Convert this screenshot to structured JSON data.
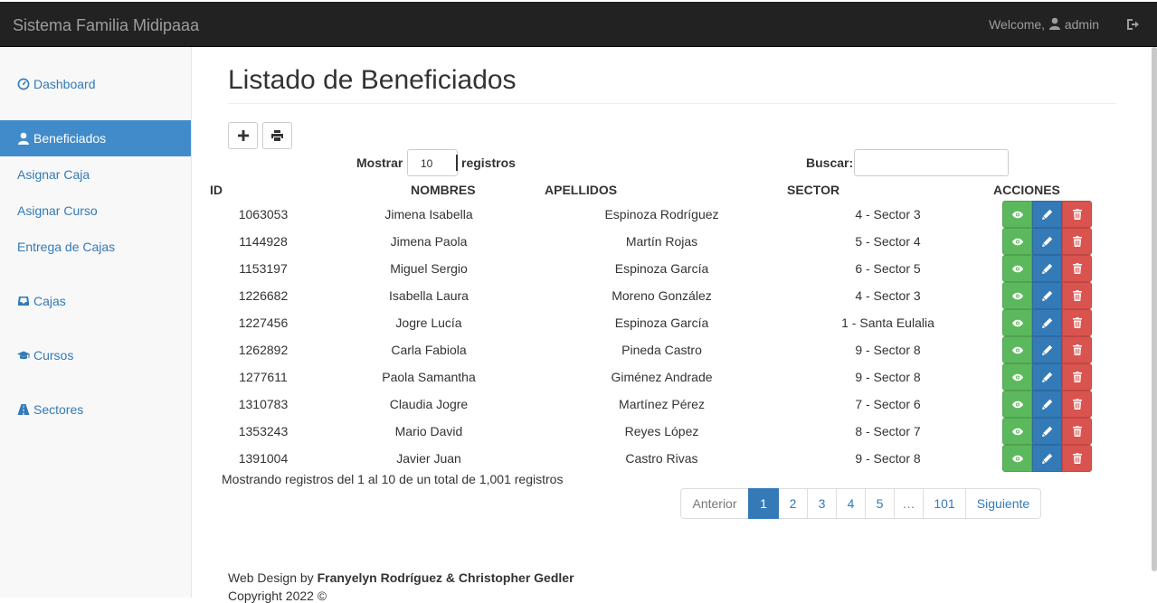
{
  "header": {
    "brand": "Sistema Familia Midipaaa",
    "welcome_prefix": "Welcome,",
    "user": "admin"
  },
  "sidebar": {
    "items": [
      {
        "label": "Dashboard",
        "icon": "dashboard-icon"
      },
      {
        "label": "Beneficiados",
        "icon": "user-icon",
        "active": true
      },
      {
        "label": "Asignar Caja"
      },
      {
        "label": "Asignar Curso"
      },
      {
        "label": "Entrega de Cajas"
      },
      {
        "label": "Cajas",
        "icon": "inbox-icon"
      },
      {
        "label": "Cursos",
        "icon": "graduation-cap-icon"
      },
      {
        "label": "Sectores",
        "icon": "road-icon"
      }
    ]
  },
  "main": {
    "title": "Listado de Beneficiados",
    "length_prefix": "Mostrar",
    "length_value": "10",
    "length_suffix": "registros",
    "search_label": "Buscar:",
    "search_value": "",
    "columns": [
      "ID",
      "NOMBRES",
      "APELLIDOS",
      "SECTOR",
      "ACCIONES"
    ],
    "rows": [
      {
        "id": "1063053",
        "nombres": "Jimena Isabella",
        "apellidos": "Espinoza Rodríguez",
        "sector": "4 - Sector 3"
      },
      {
        "id": "1144928",
        "nombres": "Jimena Paola",
        "apellidos": "Martín Rojas",
        "sector": "5 - Sector 4"
      },
      {
        "id": "1153197",
        "nombres": "Miguel Sergio",
        "apellidos": "Espinoza García",
        "sector": "6 - Sector 5"
      },
      {
        "id": "1226682",
        "nombres": "Isabella Laura",
        "apellidos": "Moreno González",
        "sector": "4 - Sector 3"
      },
      {
        "id": "1227456",
        "nombres": "Jogre Lucía",
        "apellidos": "Espinoza García",
        "sector": "1 - Santa Eulalia"
      },
      {
        "id": "1262892",
        "nombres": "Carla Fabiola",
        "apellidos": "Pineda Castro",
        "sector": "9 - Sector 8"
      },
      {
        "id": "1277611",
        "nombres": "Paola Samantha",
        "apellidos": "Giménez Andrade",
        "sector": "9 - Sector 8"
      },
      {
        "id": "1310783",
        "nombres": "Claudia Jogre",
        "apellidos": "Martínez Pérez",
        "sector": "7 - Sector 6"
      },
      {
        "id": "1353243",
        "nombres": "Mario David",
        "apellidos": "Reyes López",
        "sector": "8 - Sector 7"
      },
      {
        "id": "1391004",
        "nombres": "Javier Juan",
        "apellidos": "Castro Rivas",
        "sector": "9 - Sector 8"
      }
    ],
    "info": "Mostrando registros del 1 al 10 de un total de 1,001 registros",
    "pagination": [
      "Anterior",
      "1",
      "2",
      "3",
      "4",
      "5",
      "…",
      "101",
      "Siguiente"
    ],
    "active_page": "1"
  },
  "footer": {
    "prefix": "Web Design by",
    "authors": "Franyelyn Rodríguez & Christopher Gedler",
    "copyright": "Copyright 2022 ©"
  },
  "colors": {
    "navbar": "#222222",
    "primary": "#337ab7",
    "sidebar_active": "#428bca",
    "success": "#5cb85c",
    "danger": "#d9534f"
  }
}
